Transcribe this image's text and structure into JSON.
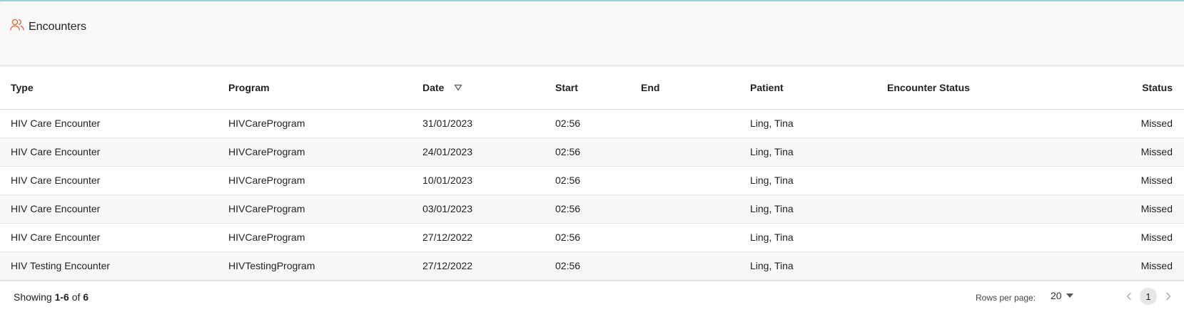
{
  "header": {
    "title": "Encounters",
    "icon": "users-icon",
    "icon_color": "#e8643c"
  },
  "table": {
    "columns": [
      {
        "key": "type",
        "label": "Type"
      },
      {
        "key": "program",
        "label": "Program"
      },
      {
        "key": "date",
        "label": "Date",
        "sorted": "descending"
      },
      {
        "key": "start",
        "label": "Start"
      },
      {
        "key": "end",
        "label": "End"
      },
      {
        "key": "patient",
        "label": "Patient"
      },
      {
        "key": "encounter_status",
        "label": "Encounter Status"
      },
      {
        "key": "status",
        "label": "Status"
      }
    ],
    "rows": [
      {
        "type": "HIV Care Encounter",
        "program": "HIVCareProgram",
        "date": "31/01/2023",
        "start": "02:56",
        "end": "",
        "patient": "Ling, Tina",
        "encounter_status": "",
        "status": "Missed"
      },
      {
        "type": "HIV Care Encounter",
        "program": "HIVCareProgram",
        "date": "24/01/2023",
        "start": "02:56",
        "end": "",
        "patient": "Ling, Tina",
        "encounter_status": "",
        "status": "Missed"
      },
      {
        "type": "HIV Care Encounter",
        "program": "HIVCareProgram",
        "date": "10/01/2023",
        "start": "02:56",
        "end": "",
        "patient": "Ling, Tina",
        "encounter_status": "",
        "status": "Missed"
      },
      {
        "type": "HIV Care Encounter",
        "program": "HIVCareProgram",
        "date": "03/01/2023",
        "start": "02:56",
        "end": "",
        "patient": "Ling, Tina",
        "encounter_status": "",
        "status": "Missed"
      },
      {
        "type": "HIV Care Encounter",
        "program": "HIVCareProgram",
        "date": "27/12/2022",
        "start": "02:56",
        "end": "",
        "patient": "Ling, Tina",
        "encounter_status": "",
        "status": "Missed"
      },
      {
        "type": "HIV Testing Encounter",
        "program": "HIVTestingProgram",
        "date": "27/12/2022",
        "start": "02:56",
        "end": "",
        "patient": "Ling, Tina",
        "encounter_status": "",
        "status": "Missed"
      }
    ]
  },
  "footer": {
    "showing_prefix": "Showing ",
    "showing_range": "1-6",
    "showing_of": " of ",
    "showing_total": "6",
    "rows_per_page_label": "Rows per page:",
    "rows_per_page_value": "20",
    "current_page": "1",
    "prev_icon": "chevron-left-icon",
    "next_icon": "chevron-right-icon"
  }
}
